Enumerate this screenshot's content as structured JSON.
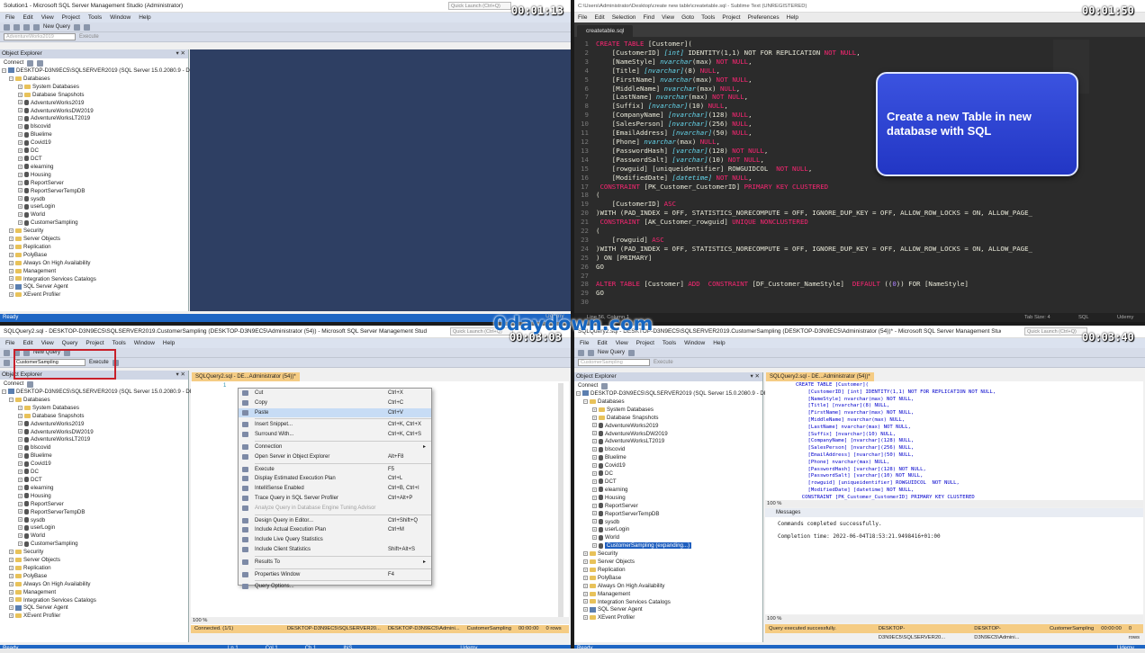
{
  "q1": {
    "title": "Solution1 - Microsoft SQL Server Management Studio (Administrator)",
    "quick_launch": "Quick Launch (Ctrl+Q)",
    "timer": "00:01:13",
    "menu": [
      "File",
      "Edit",
      "View",
      "Project",
      "Tools",
      "Window",
      "Help"
    ],
    "new_query": "New Query",
    "db_select": "AdventureWorks2019",
    "execute": "Execute",
    "oe_title": "Object Explorer",
    "connect": "Connect",
    "server": "DESKTOP-D3N9EC5\\SQLSERVER2019 (SQL Server 15.0.2080.9 - DESKTOP-D",
    "status": "Ready",
    "udemy": "Udemy"
  },
  "tree": {
    "databases": "Databases",
    "system_databases": "System Databases",
    "database_snapshots": "Database Snapshots",
    "dbs": [
      "AdventureWorks2019",
      "AdventureWorksDW2019",
      "AdventureWorksLT2019",
      "blscovid",
      "Bluelime",
      "Covid19",
      "DC",
      "DCT",
      "elearning",
      "Housing",
      "ReportServer",
      "ReportServerTempDB",
      "sysdb",
      "userLogin",
      "World",
      "CustomerSampling"
    ],
    "other": [
      "Security",
      "Server Objects",
      "Replication",
      "PolyBase",
      "Always On High Availability",
      "Management",
      "Integration Services Catalogs"
    ],
    "agent": "SQL Server Agent",
    "profiler": "XEvent Profiler"
  },
  "q2": {
    "title": "C:\\Users\\Administrator\\Desktop\\create new table\\createtable.sql - Sublime Text (UNREGISTERED)",
    "timer": "00:01:50",
    "menu": [
      "File",
      "Edit",
      "Selection",
      "Find",
      "View",
      "Goto",
      "Tools",
      "Project",
      "Preferences",
      "Help"
    ],
    "tab": "createtable.sql",
    "callout": "Create a new Table in new database with SQL",
    "status_left": "Line 56, Column 1",
    "status_tab": "Tab Size: 4",
    "status_lang": "SQL",
    "udemy": "Udemy"
  },
  "code_lines": [
    [
      {
        "k": "kw",
        "t": "CREATE TABLE "
      },
      {
        "k": "tx",
        "t": "[Customer]("
      }
    ],
    [
      {
        "k": "tx",
        "t": "    [CustomerID] "
      },
      {
        "k": "ty",
        "t": "[int]"
      },
      {
        "k": "tx",
        "t": " IDENTITY(1,1) NOT FOR REPLICATION "
      },
      {
        "k": "kw",
        "t": "NOT NULL"
      },
      {
        "k": "tx",
        "t": ","
      }
    ],
    [
      {
        "k": "tx",
        "t": "    [NameStyle] "
      },
      {
        "k": "ty",
        "t": "nvarchar"
      },
      {
        "k": "tx",
        "t": "(max) "
      },
      {
        "k": "kw",
        "t": "NOT NULL"
      },
      {
        "k": "tx",
        "t": ","
      }
    ],
    [
      {
        "k": "tx",
        "t": "    [Title] "
      },
      {
        "k": "ty",
        "t": "[nvarchar]"
      },
      {
        "k": "tx",
        "t": "(8) "
      },
      {
        "k": "kw",
        "t": "NULL"
      },
      {
        "k": "tx",
        "t": ","
      }
    ],
    [
      {
        "k": "tx",
        "t": "    [FirstName] "
      },
      {
        "k": "ty",
        "t": "nvarchar"
      },
      {
        "k": "tx",
        "t": "(max) "
      },
      {
        "k": "kw",
        "t": "NOT NULL"
      },
      {
        "k": "tx",
        "t": ","
      }
    ],
    [
      {
        "k": "tx",
        "t": "    [MiddleName] "
      },
      {
        "k": "ty",
        "t": "nvarchar"
      },
      {
        "k": "tx",
        "t": "(max) "
      },
      {
        "k": "kw",
        "t": "NULL"
      },
      {
        "k": "tx",
        "t": ","
      }
    ],
    [
      {
        "k": "tx",
        "t": "    [LastName] "
      },
      {
        "k": "ty",
        "t": "nvarchar"
      },
      {
        "k": "tx",
        "t": "(max) "
      },
      {
        "k": "kw",
        "t": "NOT NULL"
      },
      {
        "k": "tx",
        "t": ","
      }
    ],
    [
      {
        "k": "tx",
        "t": "    [Suffix] "
      },
      {
        "k": "ty",
        "t": "[nvarchar]"
      },
      {
        "k": "tx",
        "t": "(10) "
      },
      {
        "k": "kw",
        "t": "NULL"
      },
      {
        "k": "tx",
        "t": ","
      }
    ],
    [
      {
        "k": "tx",
        "t": "    [CompanyName] "
      },
      {
        "k": "ty",
        "t": "[nvarchar]"
      },
      {
        "k": "tx",
        "t": "(128) "
      },
      {
        "k": "kw",
        "t": "NULL"
      },
      {
        "k": "tx",
        "t": ","
      }
    ],
    [
      {
        "k": "tx",
        "t": "    [SalesPerson] "
      },
      {
        "k": "ty",
        "t": "[nvarchar]"
      },
      {
        "k": "tx",
        "t": "(256) "
      },
      {
        "k": "kw",
        "t": "NULL"
      },
      {
        "k": "tx",
        "t": ","
      }
    ],
    [
      {
        "k": "tx",
        "t": "    [EmailAddress] "
      },
      {
        "k": "ty",
        "t": "[nvarchar]"
      },
      {
        "k": "tx",
        "t": "(50) "
      },
      {
        "k": "kw",
        "t": "NULL"
      },
      {
        "k": "tx",
        "t": ","
      }
    ],
    [
      {
        "k": "tx",
        "t": "    [Phone] "
      },
      {
        "k": "ty",
        "t": "nvarchar"
      },
      {
        "k": "tx",
        "t": "(max) "
      },
      {
        "k": "kw",
        "t": "NULL"
      },
      {
        "k": "tx",
        "t": ","
      }
    ],
    [
      {
        "k": "tx",
        "t": "    [PasswordHash] "
      },
      {
        "k": "ty",
        "t": "[varchar]"
      },
      {
        "k": "tx",
        "t": "(128) "
      },
      {
        "k": "kw",
        "t": "NOT NULL"
      },
      {
        "k": "tx",
        "t": ","
      }
    ],
    [
      {
        "k": "tx",
        "t": "    [PasswordSalt] "
      },
      {
        "k": "ty",
        "t": "[varchar]"
      },
      {
        "k": "tx",
        "t": "(10) "
      },
      {
        "k": "kw",
        "t": "NOT NULL"
      },
      {
        "k": "tx",
        "t": ","
      }
    ],
    [
      {
        "k": "tx",
        "t": "    [rowguid] [uniqueidentifier] ROWGUIDCOL  "
      },
      {
        "k": "kw",
        "t": "NOT NULL"
      },
      {
        "k": "tx",
        "t": ","
      }
    ],
    [
      {
        "k": "tx",
        "t": "    [ModifiedDate] "
      },
      {
        "k": "ty",
        "t": "[datetime]"
      },
      {
        "k": "tx",
        "t": " "
      },
      {
        "k": "kw",
        "t": "NOT NULL"
      },
      {
        "k": "tx",
        "t": ","
      }
    ],
    [
      {
        "k": "tx",
        "t": " "
      },
      {
        "k": "kw",
        "t": "CONSTRAINT"
      },
      {
        "k": "tx",
        "t": " [PK_Customer_CustomerID] "
      },
      {
        "k": "kw",
        "t": "PRIMARY KEY CLUSTERED"
      }
    ],
    [
      {
        "k": "tx",
        "t": "("
      }
    ],
    [
      {
        "k": "tx",
        "t": "    [CustomerID] "
      },
      {
        "k": "kw",
        "t": "ASC"
      }
    ],
    [
      {
        "k": "tx",
        "t": ")WITH (PAD_INDEX = OFF, STATISTICS_NORECOMPUTE = OFF, IGNORE_DUP_KEY = OFF, ALLOW_ROW_LOCKS = ON, ALLOW_PAGE_"
      }
    ],
    [
      {
        "k": "tx",
        "t": " "
      },
      {
        "k": "kw",
        "t": "CONSTRAINT"
      },
      {
        "k": "tx",
        "t": " [AK_Customer_rowguid] "
      },
      {
        "k": "kw",
        "t": "UNIQUE NONCLUSTERED"
      }
    ],
    [
      {
        "k": "tx",
        "t": "("
      }
    ],
    [
      {
        "k": "tx",
        "t": "    [rowguid] "
      },
      {
        "k": "kw",
        "t": "ASC"
      }
    ],
    [
      {
        "k": "tx",
        "t": ")WITH (PAD_INDEX = OFF, STATISTICS_NORECOMPUTE = OFF, IGNORE_DUP_KEY = OFF, ALLOW_ROW_LOCKS = ON, ALLOW_PAGE_"
      }
    ],
    [
      {
        "k": "tx",
        "t": ") ON [PRIMARY]"
      }
    ],
    [
      {
        "k": "tx",
        "t": "GO"
      }
    ],
    [
      {
        "k": "tx",
        "t": ""
      }
    ],
    [
      {
        "k": "kw",
        "t": "ALTER TABLE"
      },
      {
        "k": "tx",
        "t": " [Customer] "
      },
      {
        "k": "kw",
        "t": "ADD"
      },
      {
        "k": "tx",
        "t": "  "
      },
      {
        "k": "kw",
        "t": "CONSTRAINT"
      },
      {
        "k": "tx",
        "t": " [DF_Customer_NameStyle]  "
      },
      {
        "k": "kw",
        "t": "DEFAULT"
      },
      {
        "k": "tx",
        "t": " (("
      },
      {
        "k": "nm",
        "t": "0"
      },
      {
        "k": "tx",
        "t": ")) FOR [NameStyle]"
      }
    ],
    [
      {
        "k": "tx",
        "t": "GO"
      }
    ],
    [
      {
        "k": "tx",
        "t": ""
      }
    ]
  ],
  "q3": {
    "title": "SQLQuery2.sql - DESKTOP-D3N9EC5\\SQLSERVER2019.CustomerSampling (DESKTOP-D3N9EC5\\Administrator (54)) - Microsoft SQL Server Management Studio (Administrator)",
    "quick_launch": "Quick Launch (Ctrl+Q)",
    "timer": "00:03:03",
    "menu": [
      "File",
      "Edit",
      "View",
      "Query",
      "Project",
      "Tools",
      "Window",
      "Help"
    ],
    "new_query": "New Query",
    "db_select": "CustomerSampling",
    "execute": "Execute",
    "oe_title": "Object Explorer",
    "connect": "Connect",
    "server": "DESKTOP-D3N9EC5\\SQLSERVER2019 (SQL Server 15.0.2080.9 - DESKTOP-D",
    "tab": "SQLQuery2.sql - DE...Administrator (54))*",
    "line1": "1",
    "zoom": "100 %",
    "connected": "Connected. (1/1)",
    "status_server": "DESKTOP-D3N9EC5\\SQLSERVER20...",
    "status_user": "DESKTOP-D3N9EC5\\Admini...",
    "status_db": "CustomerSampling",
    "status_time": "00:00:00",
    "status_rows": "0 rows",
    "ln": "Ln 1",
    "col": "Col 1",
    "ch": "Ch 1",
    "ins": "INS",
    "status": "Ready",
    "udemy": "Udemy"
  },
  "ctx_menu": [
    {
      "label": "Cut",
      "sc": "Ctrl+X",
      "dis": false
    },
    {
      "label": "Copy",
      "sc": "Ctrl+C",
      "dis": false
    },
    {
      "label": "Paste",
      "sc": "Ctrl+V",
      "dis": false,
      "hl": true
    },
    {
      "sep": true
    },
    {
      "label": "Insert Snippet...",
      "sc": "Ctrl+K, Ctrl+X"
    },
    {
      "label": "Surround With...",
      "sc": "Ctrl+K, Ctrl+S"
    },
    {
      "sep": true
    },
    {
      "label": "Connection",
      "sc": "",
      "arrow": true
    },
    {
      "label": "Open Server in Object Explorer",
      "sc": "Alt+F8"
    },
    {
      "sep": true
    },
    {
      "label": "Execute",
      "sc": "F5"
    },
    {
      "label": "Display Estimated Execution Plan",
      "sc": "Ctrl+L"
    },
    {
      "label": "IntelliSense Enabled",
      "sc": "Ctrl+B, Ctrl+I"
    },
    {
      "label": "Trace Query in SQL Server Profiler",
      "sc": "Ctrl+Alt+P"
    },
    {
      "label": "Analyze Query in Database Engine Tuning Advisor",
      "sc": "",
      "dis": true
    },
    {
      "sep": true
    },
    {
      "label": "Design Query in Editor...",
      "sc": "Ctrl+Shift+Q"
    },
    {
      "label": "Include Actual Execution Plan",
      "sc": "Ctrl+M"
    },
    {
      "label": "Include Live Query Statistics",
      "sc": ""
    },
    {
      "label": "Include Client Statistics",
      "sc": "Shift+Alt+S"
    },
    {
      "sep": true
    },
    {
      "label": "Results To",
      "sc": "",
      "arrow": true
    },
    {
      "sep": true
    },
    {
      "label": "Properties Window",
      "sc": "F4"
    },
    {
      "sep": true
    },
    {
      "label": "Query Options...",
      "sc": ""
    }
  ],
  "q4": {
    "title": "SQLQuery2.sql - DESKTOP-D3N9EC5\\SQLSERVER2019.CustomerSampling (DESKTOP-D3N9EC5\\Administrator (54))* - Microsoft SQL Server Management Studio (Administrator)",
    "quick_launch": "Quick Launch (Ctrl+Q)",
    "timer": "00:03:40",
    "menu": [
      "File",
      "Edit",
      "View",
      "Project",
      "Tools",
      "Window",
      "Help"
    ],
    "new_query": "New Query",
    "db_select": "CustomerSampling",
    "execute": "Execute",
    "oe_title": "Object Explorer",
    "connect": "Connect",
    "server": "DESKTOP-D3N9EC5\\SQLSERVER2019 (SQL Server 15.0.2080.9 - DESKTC",
    "expanding": "CustomerSampling (expanding...)",
    "tab": "SQLQuery2.sql - DE...Administrator (54))*",
    "zoom1": "100 %",
    "messages_tab": "Messages",
    "msg1": "Commands completed successfully.",
    "msg2": "Completion time: 2022-06-04T18:53:21.9498416+01:00",
    "zoom2": "100 %",
    "success": "Query executed successfully.",
    "status_server": "DESKTOP-D3N9EC5\\SQLSERVER20...",
    "status_user": "DESKTOP-D3N9EC5\\Admini...",
    "status_db": "CustomerSampling",
    "status_time": "00:00:00",
    "status_rows": "0 rows",
    "status": "Ready",
    "udemy": "Udemy"
  },
  "q4_code": [
    "CREATE TABLE [Customer](",
    "    [CustomerID] [int] IDENTITY(1,1) NOT FOR REPLICATION NOT NULL,",
    "    [NameStyle] nvarchar(max) NOT NULL,",
    "    [Title] [nvarchar](8) NULL,",
    "    [FirstName] nvarchar(max) NOT NULL,",
    "    [MiddleName] nvarchar(max) NULL,",
    "    [LastName] nvarchar(max) NOT NULL,",
    "    [Suffix] [nvarchar](10) NULL,",
    "    [CompanyName] [nvarchar](128) NULL,",
    "    [SalesPerson] [nvarchar](256) NULL,",
    "    [EmailAddress] [nvarchar](50) NULL,",
    "    [Phone] nvarchar(max) NULL,",
    "    [PasswordHash] [varchar](128) NOT NULL,",
    "    [PasswordSalt] [varchar](10) NOT NULL,",
    "    [rowguid] [uniqueidentifier] ROWGUIDCOL  NOT NULL,",
    "    [ModifiedDate] [datetime] NOT NULL,",
    "  CONSTRAINT [PK_Customer_CustomerID] PRIMARY KEY CLUSTERED"
  ],
  "watermark": "0daydown.com",
  "colors": {
    "statusbar": "#1e66c4",
    "navy": "#2e3f63",
    "callout": "#2a3fd6",
    "highlight": "#c8202a"
  }
}
